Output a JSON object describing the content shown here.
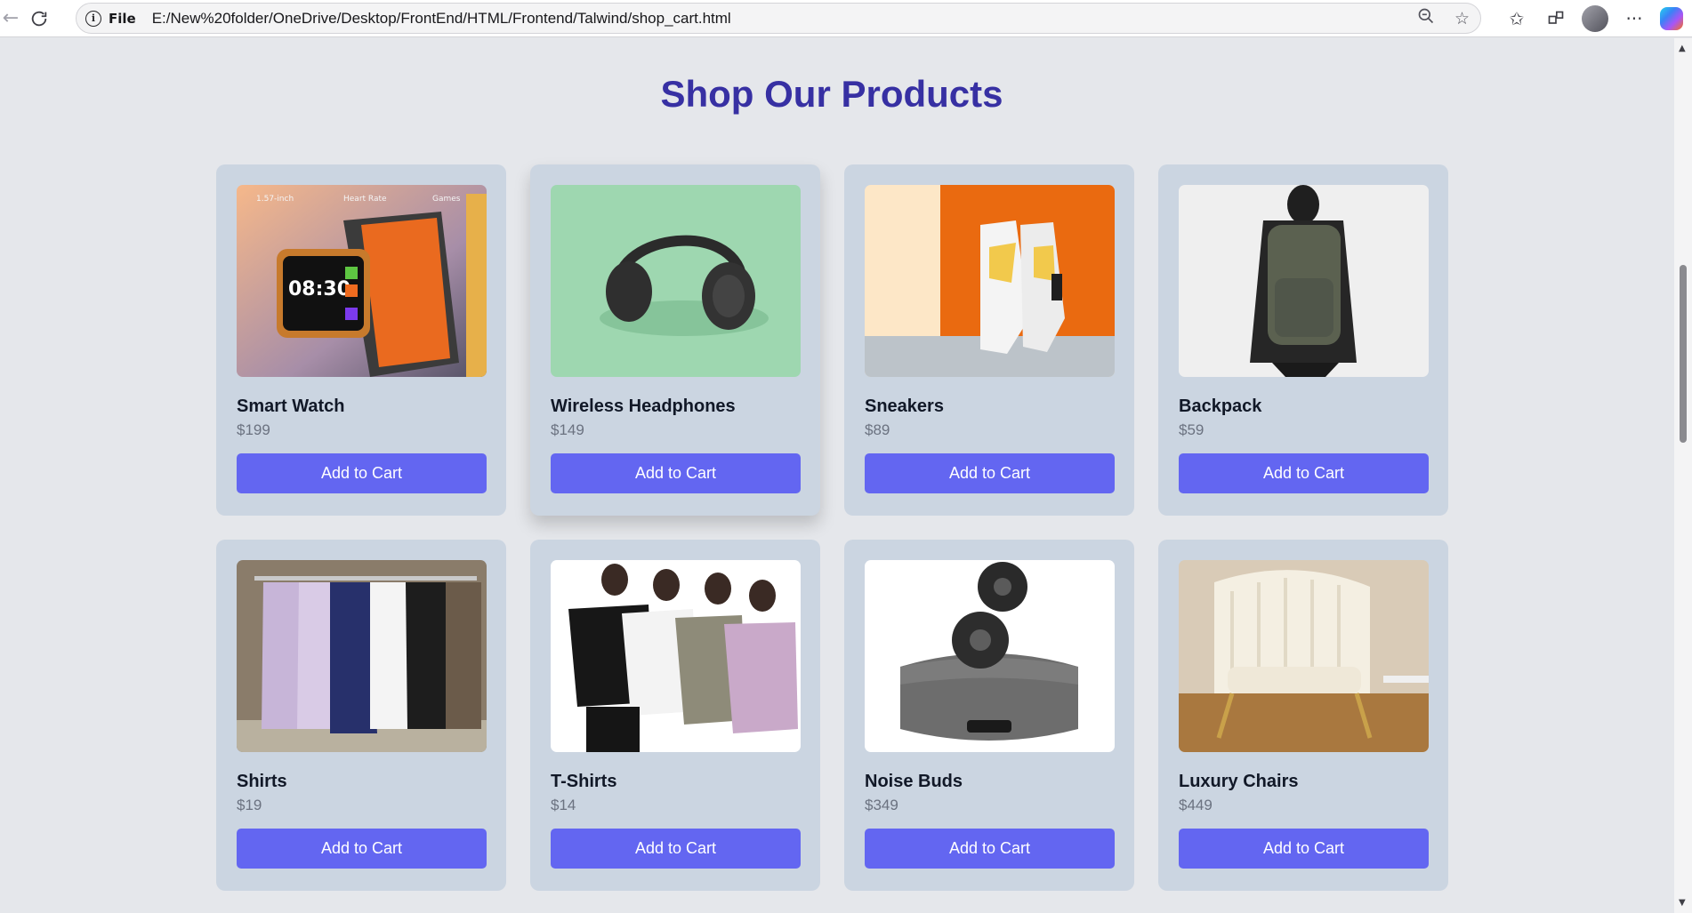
{
  "browser": {
    "file_label": "File",
    "url": "E:/New%20folder/OneDrive/Desktop/FrontEnd/HTML/Frontend/Talwind/shop_cart.html"
  },
  "page": {
    "title": "Shop Our Products"
  },
  "colors": {
    "title": "#3730a3",
    "card_bg": "#cbd5e1",
    "button_bg": "#6366f1",
    "page_bg": "#e5e7eb"
  },
  "products": [
    {
      "name": "Smart Watch",
      "price": "$199",
      "button": "Add to Cart",
      "image_text": {
        "watch_time": "08:30",
        "watch_label_1": "1.57-inch",
        "watch_label_2": "Heart Rate",
        "watch_label_3": "Games"
      }
    },
    {
      "name": "Wireless Headphones",
      "price": "$149",
      "button": "Add to Cart"
    },
    {
      "name": "Sneakers",
      "price": "$89",
      "button": "Add to Cart"
    },
    {
      "name": "Backpack",
      "price": "$59",
      "button": "Add to Cart"
    },
    {
      "name": "Shirts",
      "price": "$19",
      "button": "Add to Cart"
    },
    {
      "name": "T-Shirts",
      "price": "$14",
      "button": "Add to Cart"
    },
    {
      "name": "Noise Buds",
      "price": "$349",
      "button": "Add to Cart"
    },
    {
      "name": "Luxury Chairs",
      "price": "$449",
      "button": "Add to Cart"
    }
  ]
}
